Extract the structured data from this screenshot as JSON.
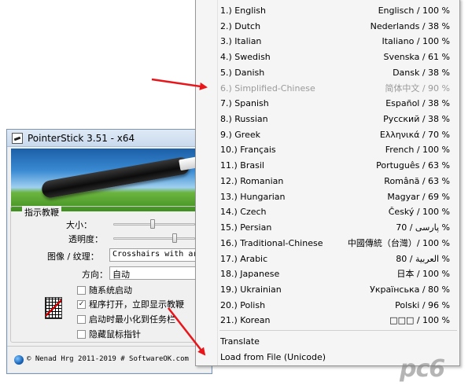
{
  "window": {
    "title": "PointerStick 3.51 - x64",
    "group_title": "指示教鞭",
    "size_label": "大小：",
    "size_level": 0.45,
    "opacity_label": "透明度：",
    "opacity_level": 0.72,
    "image_label": "图像 / 纹理：",
    "image_value": "Crosshairs with arrow",
    "direction_label": "方向：",
    "direction_value": "自动",
    "checkboxes": [
      {
        "label": "随系统启动",
        "checked": false
      },
      {
        "label": "程序打开，立即显示教鞭",
        "checked": true
      },
      {
        "label": "启动时最小化到任务栏",
        "checked": false
      },
      {
        "label": "隐藏鼠标指针",
        "checked": false
      }
    ],
    "footer": "© Nenad Hrg 2011-2019 # SoftwareOK.com"
  },
  "menu": {
    "languages": [
      {
        "left": "1.) English",
        "right": "Englisch / 100 %",
        "disabled": false
      },
      {
        "left": "2.) Dutch",
        "right": "Nederlands / 38 %",
        "disabled": false
      },
      {
        "left": "3.) Italian",
        "right": "Italiano / 100 %",
        "disabled": false
      },
      {
        "left": "4.) Swedish",
        "right": "Svenska / 61 %",
        "disabled": false
      },
      {
        "left": "5.) Danish",
        "right": "Dansk / 38 %",
        "disabled": false
      },
      {
        "left": "6.) Simplified-Chinese",
        "right": "简体中文 / 90 %",
        "disabled": true
      },
      {
        "left": "7.) Spanish",
        "right": "Español / 38 %",
        "disabled": false
      },
      {
        "left": "8.) Russian",
        "right": "Русский / 38 %",
        "disabled": false
      },
      {
        "left": "9.) Greek",
        "right": "Ελληνικά / 70 %",
        "disabled": false
      },
      {
        "left": "10.) Français",
        "right": "French / 100 %",
        "disabled": false
      },
      {
        "left": "11.) Brasil",
        "right": "Português / 63 %",
        "disabled": false
      },
      {
        "left": "12.) Romanian",
        "right": "Română / 63 %",
        "disabled": false
      },
      {
        "left": "13.) Hungarian",
        "right": "Magyar / 69 %",
        "disabled": false
      },
      {
        "left": "14.) Czech",
        "right": "Český / 100 %",
        "disabled": false
      },
      {
        "left": "15.) Persian",
        "right": "70 / پارسی %",
        "disabled": false
      },
      {
        "left": "16.) Traditional-Chinese",
        "right": "中國傳統（台灣）/ 100 %",
        "disabled": false
      },
      {
        "left": "17.) Arabic",
        "right": "80 / العربية %",
        "disabled": false
      },
      {
        "left": "18.) Japanese",
        "right": "日本 / 100 %",
        "disabled": false
      },
      {
        "left": "19.) Ukrainian",
        "right": "Українська / 80 %",
        "disabled": false
      },
      {
        "left": "20.) Polish",
        "right": "Polski / 96 %",
        "disabled": false
      },
      {
        "left": "21.) Korean",
        "right": "□□□ / 100 %",
        "disabled": false
      }
    ],
    "translate": "Translate",
    "load_from_file": "Load from File (Unicode)"
  },
  "watermark": "pc6",
  "colors": {
    "arrow": "#e8161b",
    "banner_sky": "#3a8ad2",
    "banner_grass": "#4f9f2b"
  }
}
